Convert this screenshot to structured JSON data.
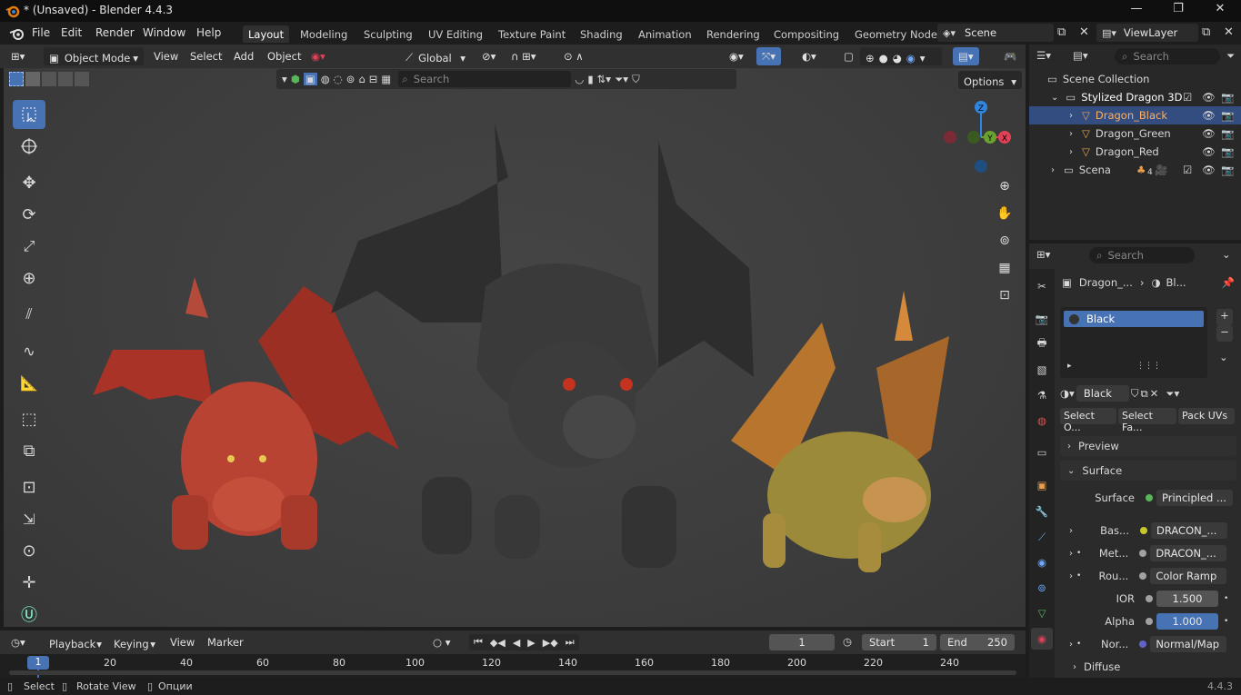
{
  "window": {
    "title": "* (Unsaved) - Blender 4.4.3",
    "minimize": "—",
    "maximize": "❐",
    "close": "✕"
  },
  "menu": [
    "File",
    "Edit",
    "Render",
    "Window",
    "Help"
  ],
  "workspaces": [
    "Layout",
    "Modeling",
    "Sculpting",
    "UV Editing",
    "Texture Paint",
    "Shading",
    "Animation",
    "Rendering",
    "Compositing",
    "Geometry Node"
  ],
  "scene": {
    "name": "Scene",
    "view_layer": "ViewLayer"
  },
  "viewport_header": {
    "mode": "Object Mode",
    "menus": [
      "View",
      "Select",
      "Add",
      "Object"
    ],
    "orientation": "Global",
    "search_placeholder": "Search",
    "options": "Options"
  },
  "outliner": {
    "search_placeholder": "Search",
    "root": "Scene Collection",
    "collection": "Stylized Dragon 3D",
    "objects": [
      "Dragon_Black",
      "Dragon_Green",
      "Dragon_Red"
    ],
    "other_collection": "Scena",
    "scena_count": "4"
  },
  "properties": {
    "search_placeholder": "Search",
    "breadcrumb_object": "Dragon_...",
    "breadcrumb_material": "Bl...",
    "material_slot": "Black",
    "material_name": "Black",
    "buttons": [
      "Select O...",
      "Select Fa...",
      "Pack UVs"
    ],
    "panels": {
      "preview": "Preview",
      "surface": "Surface",
      "diffuse": "Diffuse"
    },
    "surface": {
      "label": "Surface",
      "value": "Principled ..."
    },
    "inputs": [
      {
        "label": "Bas...",
        "value": "DRACON_...",
        "socket": "#c7c729"
      },
      {
        "label": "Met...",
        "value": "DRACON_...",
        "socket": "#a1a1a1"
      },
      {
        "label": "Rou...",
        "value": "Color Ramp",
        "socket": "#a1a1a1"
      },
      {
        "label": "IOR",
        "value": "1.500",
        "socket": "#a1a1a1"
      },
      {
        "label": "Alpha",
        "value": "1.000",
        "socket": "#a1a1a1"
      },
      {
        "label": "Nor...",
        "value": "Normal/Map",
        "socket": "#6363c7"
      }
    ]
  },
  "timeline": {
    "menus": [
      "Playback",
      "Keying",
      "View",
      "Marker"
    ],
    "current_frame": "1",
    "start_label": "Start",
    "start": "1",
    "end_label": "End",
    "end": "250",
    "ticks": [
      "1",
      "20",
      "40",
      "60",
      "80",
      "100",
      "120",
      "140",
      "160",
      "180",
      "200",
      "220",
      "240"
    ]
  },
  "status": {
    "select": "Select",
    "rotate": "Rotate View",
    "options": "Опции",
    "version": "4.4.3"
  },
  "gizmo": {
    "x": "X",
    "y": "Y",
    "z": "Z"
  },
  "colors": {
    "accent": "#4772b3",
    "x_axis": "#e04156",
    "y_axis": "#6aa22f",
    "z_axis": "#2f86e0"
  }
}
